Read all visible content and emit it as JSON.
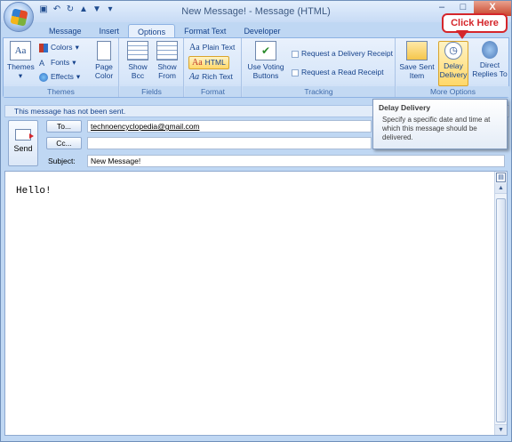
{
  "window": {
    "title": "New Message! - Message (HTML)",
    "minimize": "–",
    "maximize": "□",
    "close": "X"
  },
  "tabs": [
    {
      "label": "Message"
    },
    {
      "label": "Insert"
    },
    {
      "label": "Options"
    },
    {
      "label": "Format Text"
    },
    {
      "label": "Developer"
    }
  ],
  "ribbon": {
    "themes_group": {
      "label": "Themes",
      "themes_button": "Themes",
      "colors": "Colors",
      "fonts": "Fonts",
      "effects": "Effects",
      "page_color": "Page Color"
    },
    "fields_group": {
      "label": "Fields",
      "show_bcc": "Show Bcc",
      "show_from": "Show From"
    },
    "format_group": {
      "label": "Format",
      "plain_text": "Plain Text",
      "html": "HTML",
      "rich_text": "Rich Text"
    },
    "tracking_group": {
      "label": "Tracking",
      "use_voting": "Use Voting Buttons",
      "delivery_receipt": "Request a Delivery Receipt",
      "read_receipt": "Request a Read Receipt"
    },
    "more_options_group": {
      "label": "More Options",
      "save_sent": "Save Sent Item",
      "delay_delivery": "Delay Delivery",
      "direct_replies": "Direct Replies To"
    }
  },
  "callout": {
    "text": "Click Here"
  },
  "infobar": {
    "text": "This message has not been sent."
  },
  "header": {
    "send": "Send",
    "to_button": "To...",
    "to_value": "technoencyclopedia@gmail.com",
    "cc_button": "Cc...",
    "cc_value": "",
    "subject_label": "Subject:",
    "subject_value": "New Message!"
  },
  "tooltip": {
    "title": "Delay Delivery",
    "body": "Specify a specific date and time at which this message should be delivered."
  },
  "body": {
    "text": "Hello!"
  }
}
